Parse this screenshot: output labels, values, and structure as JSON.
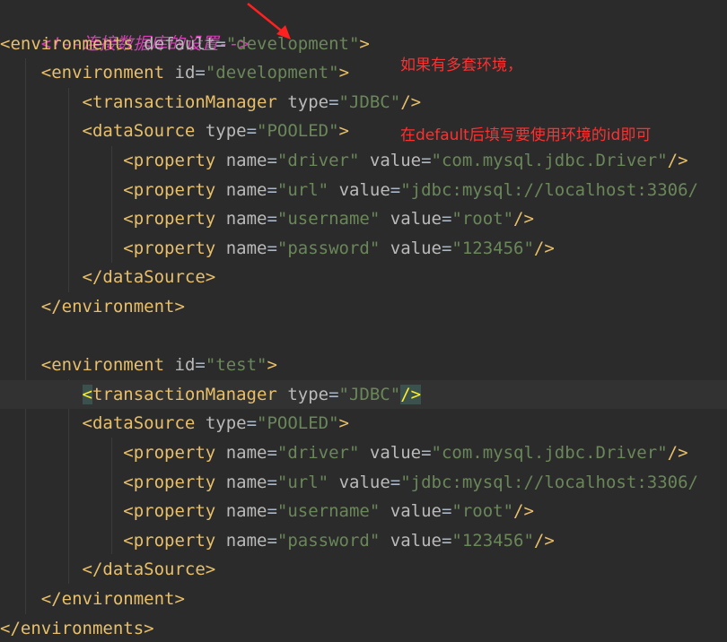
{
  "comment_line": "<!--连接数据库的设置-->",
  "annotation": {
    "line1": "如果有多套环境，",
    "line2": "在default后填写要使用环境的id即可"
  },
  "colors": {
    "background": "#2b2b2b",
    "tag": "#e8bf6a",
    "attribute": "#bababa",
    "value": "#6a8759",
    "comment": "#d43fb5",
    "annotation": "#ff3030"
  },
  "code": {
    "envs_open_tag": "<environments",
    "envs_attr": "default",
    "envs_value": "\"development\"",
    "envs_close_bracket": ">",
    "envs_close": "</environments>",
    "env1_open_tag": "<environment",
    "env1_attr": "id",
    "env1_value": "\"development\"",
    "env1_close_bracket": ">",
    "env2_open_tag": "<environment",
    "env2_attr": "id",
    "env2_value": "\"test\"",
    "env2_close_bracket": ">",
    "env_close": "</environment>",
    "tm_open_bracket": "<",
    "tm_tag": "transactionManager",
    "tm_attr": "type",
    "tm_value": "\"JDBC\"",
    "tm_selfclose": "/>",
    "ds_open_tag": "<dataSource",
    "ds_attr": "type",
    "ds_value": "\"POOLED\"",
    "ds_close_bracket": ">",
    "ds_close": "</dataSource>",
    "prop_tag": "<property",
    "name_attr": "name",
    "value_attr": "value",
    "selfclose": "/>",
    "equals": "=",
    "prop_driver_name": "\"driver\"",
    "prop_driver_value": "\"com.mysql.jdbc.Driver\"",
    "prop_url_name": "\"url\"",
    "prop_url_value": "\"jdbc:mysql://localhost:3306/",
    "prop_user_name": "\"username\"",
    "prop_user_value": "\"root\"",
    "prop_pass_name": "\"password\"",
    "prop_pass_value": "\"123456\""
  }
}
